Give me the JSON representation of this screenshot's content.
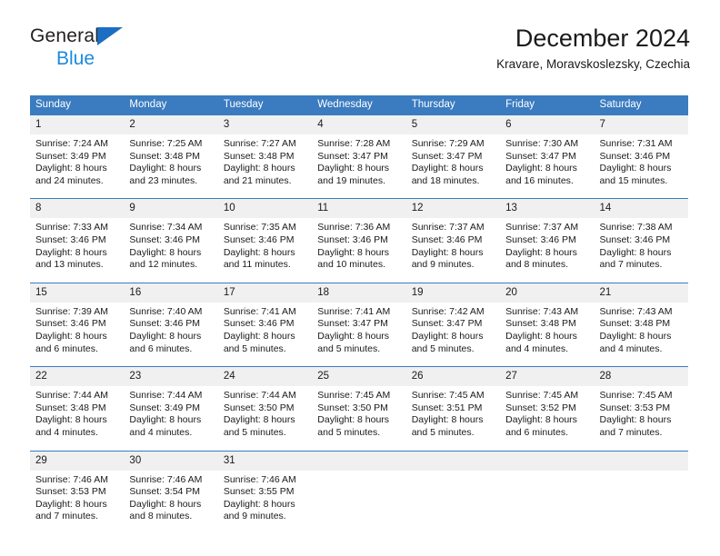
{
  "brand": {
    "name_part1": "General",
    "name_part2": "Blue",
    "logo_icon": "blue-triangle-icon",
    "colors": {
      "part1": "#231f20",
      "part2": "#1b8ae0",
      "triangle": "#1b6ec2"
    }
  },
  "header": {
    "title": "December 2024",
    "subtitle": "Kravare, Moravskoslezsky, Czechia"
  },
  "theme": {
    "header_bg": "#3b7bbf",
    "header_text": "#ffffff",
    "daynum_bg": "#f0f0f0",
    "row_divider": "#3b7bbf",
    "page_bg": "#ffffff",
    "body_text": "#1a1a1a"
  },
  "calendar": {
    "weekday_headers": [
      "Sunday",
      "Monday",
      "Tuesday",
      "Wednesday",
      "Thursday",
      "Friday",
      "Saturday"
    ],
    "weeks": [
      [
        {
          "day": "1",
          "sunrise": "Sunrise: 7:24 AM",
          "sunset": "Sunset: 3:49 PM",
          "daylight_line1": "Daylight: 8 hours",
          "daylight_line2": "and 24 minutes."
        },
        {
          "day": "2",
          "sunrise": "Sunrise: 7:25 AM",
          "sunset": "Sunset: 3:48 PM",
          "daylight_line1": "Daylight: 8 hours",
          "daylight_line2": "and 23 minutes."
        },
        {
          "day": "3",
          "sunrise": "Sunrise: 7:27 AM",
          "sunset": "Sunset: 3:48 PM",
          "daylight_line1": "Daylight: 8 hours",
          "daylight_line2": "and 21 minutes."
        },
        {
          "day": "4",
          "sunrise": "Sunrise: 7:28 AM",
          "sunset": "Sunset: 3:47 PM",
          "daylight_line1": "Daylight: 8 hours",
          "daylight_line2": "and 19 minutes."
        },
        {
          "day": "5",
          "sunrise": "Sunrise: 7:29 AM",
          "sunset": "Sunset: 3:47 PM",
          "daylight_line1": "Daylight: 8 hours",
          "daylight_line2": "and 18 minutes."
        },
        {
          "day": "6",
          "sunrise": "Sunrise: 7:30 AM",
          "sunset": "Sunset: 3:47 PM",
          "daylight_line1": "Daylight: 8 hours",
          "daylight_line2": "and 16 minutes."
        },
        {
          "day": "7",
          "sunrise": "Sunrise: 7:31 AM",
          "sunset": "Sunset: 3:46 PM",
          "daylight_line1": "Daylight: 8 hours",
          "daylight_line2": "and 15 minutes."
        }
      ],
      [
        {
          "day": "8",
          "sunrise": "Sunrise: 7:33 AM",
          "sunset": "Sunset: 3:46 PM",
          "daylight_line1": "Daylight: 8 hours",
          "daylight_line2": "and 13 minutes."
        },
        {
          "day": "9",
          "sunrise": "Sunrise: 7:34 AM",
          "sunset": "Sunset: 3:46 PM",
          "daylight_line1": "Daylight: 8 hours",
          "daylight_line2": "and 12 minutes."
        },
        {
          "day": "10",
          "sunrise": "Sunrise: 7:35 AM",
          "sunset": "Sunset: 3:46 PM",
          "daylight_line1": "Daylight: 8 hours",
          "daylight_line2": "and 11 minutes."
        },
        {
          "day": "11",
          "sunrise": "Sunrise: 7:36 AM",
          "sunset": "Sunset: 3:46 PM",
          "daylight_line1": "Daylight: 8 hours",
          "daylight_line2": "and 10 minutes."
        },
        {
          "day": "12",
          "sunrise": "Sunrise: 7:37 AM",
          "sunset": "Sunset: 3:46 PM",
          "daylight_line1": "Daylight: 8 hours",
          "daylight_line2": "and 9 minutes."
        },
        {
          "day": "13",
          "sunrise": "Sunrise: 7:37 AM",
          "sunset": "Sunset: 3:46 PM",
          "daylight_line1": "Daylight: 8 hours",
          "daylight_line2": "and 8 minutes."
        },
        {
          "day": "14",
          "sunrise": "Sunrise: 7:38 AM",
          "sunset": "Sunset: 3:46 PM",
          "daylight_line1": "Daylight: 8 hours",
          "daylight_line2": "and 7 minutes."
        }
      ],
      [
        {
          "day": "15",
          "sunrise": "Sunrise: 7:39 AM",
          "sunset": "Sunset: 3:46 PM",
          "daylight_line1": "Daylight: 8 hours",
          "daylight_line2": "and 6 minutes."
        },
        {
          "day": "16",
          "sunrise": "Sunrise: 7:40 AM",
          "sunset": "Sunset: 3:46 PM",
          "daylight_line1": "Daylight: 8 hours",
          "daylight_line2": "and 6 minutes."
        },
        {
          "day": "17",
          "sunrise": "Sunrise: 7:41 AM",
          "sunset": "Sunset: 3:46 PM",
          "daylight_line1": "Daylight: 8 hours",
          "daylight_line2": "and 5 minutes."
        },
        {
          "day": "18",
          "sunrise": "Sunrise: 7:41 AM",
          "sunset": "Sunset: 3:47 PM",
          "daylight_line1": "Daylight: 8 hours",
          "daylight_line2": "and 5 minutes."
        },
        {
          "day": "19",
          "sunrise": "Sunrise: 7:42 AM",
          "sunset": "Sunset: 3:47 PM",
          "daylight_line1": "Daylight: 8 hours",
          "daylight_line2": "and 5 minutes."
        },
        {
          "day": "20",
          "sunrise": "Sunrise: 7:43 AM",
          "sunset": "Sunset: 3:48 PM",
          "daylight_line1": "Daylight: 8 hours",
          "daylight_line2": "and 4 minutes."
        },
        {
          "day": "21",
          "sunrise": "Sunrise: 7:43 AM",
          "sunset": "Sunset: 3:48 PM",
          "daylight_line1": "Daylight: 8 hours",
          "daylight_line2": "and 4 minutes."
        }
      ],
      [
        {
          "day": "22",
          "sunrise": "Sunrise: 7:44 AM",
          "sunset": "Sunset: 3:48 PM",
          "daylight_line1": "Daylight: 8 hours",
          "daylight_line2": "and 4 minutes."
        },
        {
          "day": "23",
          "sunrise": "Sunrise: 7:44 AM",
          "sunset": "Sunset: 3:49 PM",
          "daylight_line1": "Daylight: 8 hours",
          "daylight_line2": "and 4 minutes."
        },
        {
          "day": "24",
          "sunrise": "Sunrise: 7:44 AM",
          "sunset": "Sunset: 3:50 PM",
          "daylight_line1": "Daylight: 8 hours",
          "daylight_line2": "and 5 minutes."
        },
        {
          "day": "25",
          "sunrise": "Sunrise: 7:45 AM",
          "sunset": "Sunset: 3:50 PM",
          "daylight_line1": "Daylight: 8 hours",
          "daylight_line2": "and 5 minutes."
        },
        {
          "day": "26",
          "sunrise": "Sunrise: 7:45 AM",
          "sunset": "Sunset: 3:51 PM",
          "daylight_line1": "Daylight: 8 hours",
          "daylight_line2": "and 5 minutes."
        },
        {
          "day": "27",
          "sunrise": "Sunrise: 7:45 AM",
          "sunset": "Sunset: 3:52 PM",
          "daylight_line1": "Daylight: 8 hours",
          "daylight_line2": "and 6 minutes."
        },
        {
          "day": "28",
          "sunrise": "Sunrise: 7:45 AM",
          "sunset": "Sunset: 3:53 PM",
          "daylight_line1": "Daylight: 8 hours",
          "daylight_line2": "and 7 minutes."
        }
      ],
      [
        {
          "day": "29",
          "sunrise": "Sunrise: 7:46 AM",
          "sunset": "Sunset: 3:53 PM",
          "daylight_line1": "Daylight: 8 hours",
          "daylight_line2": "and 7 minutes."
        },
        {
          "day": "30",
          "sunrise": "Sunrise: 7:46 AM",
          "sunset": "Sunset: 3:54 PM",
          "daylight_line1": "Daylight: 8 hours",
          "daylight_line2": "and 8 minutes."
        },
        {
          "day": "31",
          "sunrise": "Sunrise: 7:46 AM",
          "sunset": "Sunset: 3:55 PM",
          "daylight_line1": "Daylight: 8 hours",
          "daylight_line2": "and 9 minutes."
        },
        {
          "day": "",
          "sunrise": "",
          "sunset": "",
          "daylight_line1": "",
          "daylight_line2": ""
        },
        {
          "day": "",
          "sunrise": "",
          "sunset": "",
          "daylight_line1": "",
          "daylight_line2": ""
        },
        {
          "day": "",
          "sunrise": "",
          "sunset": "",
          "daylight_line1": "",
          "daylight_line2": ""
        },
        {
          "day": "",
          "sunrise": "",
          "sunset": "",
          "daylight_line1": "",
          "daylight_line2": ""
        }
      ]
    ]
  }
}
